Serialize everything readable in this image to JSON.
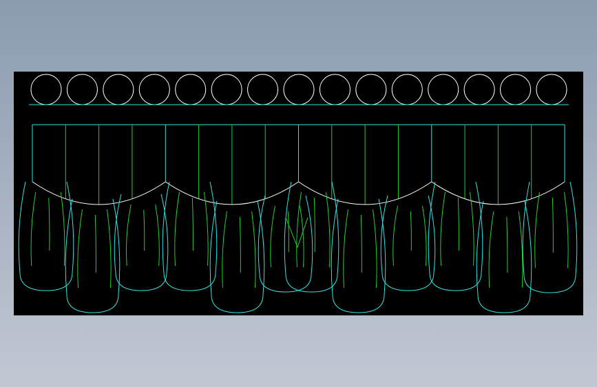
{
  "canvas": {
    "background": "#000000",
    "page_gradient": [
      "#8b9bb0",
      "#c2c7d3"
    ]
  },
  "colors": {
    "outline": "#ffffff",
    "cyan": "#2ee6e6",
    "green": "#22d12e"
  },
  "drawing": {
    "scallop_circle_count": 15,
    "pleat_panel_count": 16,
    "swag_count": 4,
    "tail_count": 12
  }
}
